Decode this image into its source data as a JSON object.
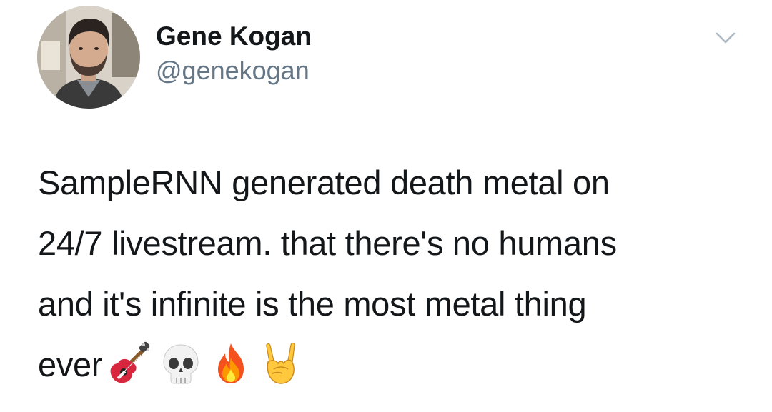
{
  "tweet": {
    "author": {
      "display_name": "Gene Kogan",
      "handle": "@genekogan"
    },
    "text_lines": [
      "SampleRNN generated death metal on",
      "24/7 livestream. that there's no humans",
      "and it's infinite is the most metal thing",
      "ever"
    ],
    "emojis": [
      "guitar-icon",
      "skull-icon",
      "fire-icon",
      "sign-of-the-horns-icon"
    ]
  },
  "colors": {
    "text": "#14171a",
    "secondary_text": "#657786",
    "background": "#ffffff",
    "chevron": "#aab8c2"
  }
}
